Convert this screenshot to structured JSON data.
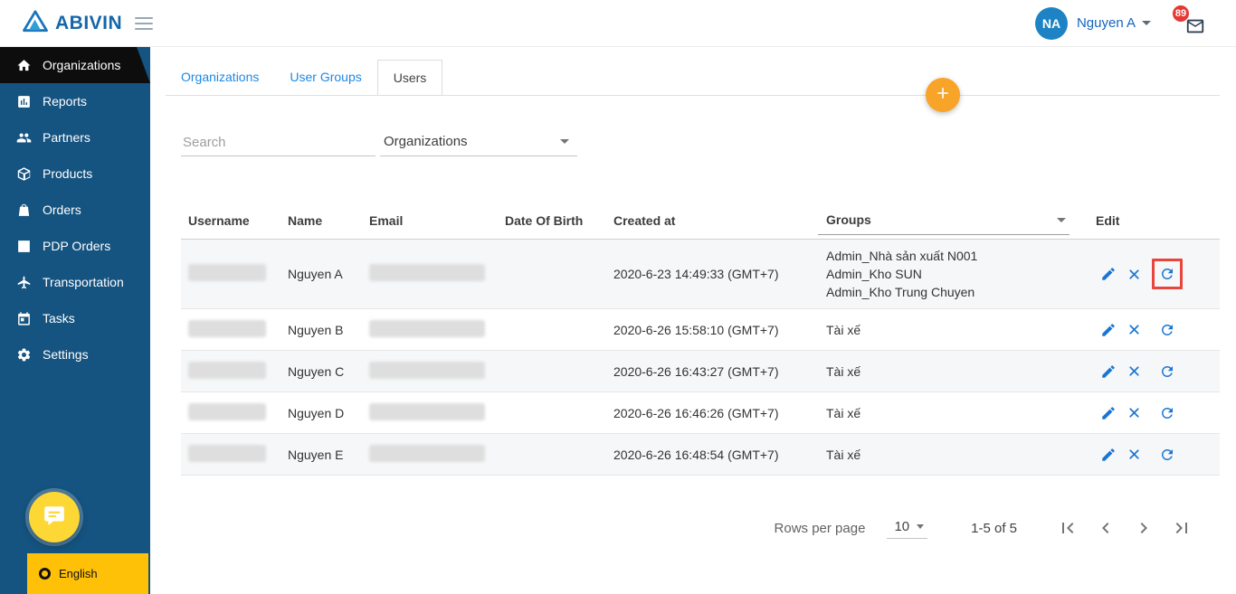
{
  "brand": {
    "name": "ABIVIN"
  },
  "topbar": {
    "user_initials": "NA",
    "user_name": "Nguyen A",
    "notification_count": "89"
  },
  "sidebar": {
    "items": [
      {
        "label": "Organizations",
        "icon": "home",
        "active": true
      },
      {
        "label": "Reports",
        "icon": "bar-chart",
        "active": false
      },
      {
        "label": "Partners",
        "icon": "people",
        "active": false
      },
      {
        "label": "Products",
        "icon": "cube",
        "active": false
      },
      {
        "label": "Orders",
        "icon": "bag",
        "active": false
      },
      {
        "label": "PDP Orders",
        "icon": "list",
        "active": false
      },
      {
        "label": "Transportation",
        "icon": "plane",
        "active": false
      },
      {
        "label": "Tasks",
        "icon": "calendar",
        "active": false
      },
      {
        "label": "Settings",
        "icon": "gear",
        "active": false
      }
    ],
    "language_label": "English"
  },
  "tabs": [
    {
      "label": "Organizations",
      "active": false
    },
    {
      "label": "User Groups",
      "active": false
    },
    {
      "label": "Users",
      "active": true
    }
  ],
  "filters": {
    "search_placeholder": "Search",
    "organization_filter_value": "Organizations"
  },
  "table": {
    "columns": [
      "Username",
      "Name",
      "Email",
      "Date Of Birth",
      "Created at",
      "Groups",
      "Edit"
    ],
    "row_actions": [
      {
        "name": "edit-button",
        "icon": "edit"
      },
      {
        "name": "delete-button",
        "icon": "close"
      },
      {
        "name": "refresh-button",
        "icon": "refresh"
      }
    ],
    "rows": [
      {
        "name": "Nguyen A",
        "date_of_birth": "",
        "created_at": "2020-6-23 14:49:33 (GMT+7)",
        "groups": [
          "Admin_Nhà sản xuất N001",
          "Admin_Kho SUN",
          "Admin_Kho Trung Chuyen"
        ],
        "highlight_refresh": true
      },
      {
        "name": "Nguyen B",
        "date_of_birth": "",
        "created_at": "2020-6-26 15:58:10 (GMT+7)",
        "groups": [
          "Tài xế"
        ],
        "highlight_refresh": false
      },
      {
        "name": "Nguyen C",
        "date_of_birth": "",
        "created_at": "2020-6-26 16:43:27 (GMT+7)",
        "groups": [
          "Tài xế"
        ],
        "highlight_refresh": false
      },
      {
        "name": "Nguyen D",
        "date_of_birth": "",
        "created_at": "2020-6-26 16:46:26 (GMT+7)",
        "groups": [
          "Tài xế"
        ],
        "highlight_refresh": false
      },
      {
        "name": "Nguyen E",
        "date_of_birth": "",
        "created_at": "2020-6-26 16:48:54 (GMT+7)",
        "groups": [
          "Tài xế"
        ],
        "highlight_refresh": false
      }
    ]
  },
  "pagination": {
    "rows_per_page_label": "Rows per page",
    "rows_per_page_value": "10",
    "range_label": "1-5 of 5",
    "buttons": [
      "first-page",
      "chevron-left",
      "chevron-right",
      "last-page"
    ]
  },
  "colors": {
    "sidebar_bg": "#155380",
    "sidebar_active_bg": "#0d0d0d",
    "accent_blue": "#1976d2",
    "link_blue": "#1e88e5",
    "topbar_user_blue": "#1565c0",
    "fab_orange": "#f7a428",
    "badge_red": "#e53935",
    "highlight_red": "#e8453c",
    "language_yellow": "#ffc107",
    "chat_yellow": "#fdd835",
    "avatar_blue": "#1d83c5"
  }
}
